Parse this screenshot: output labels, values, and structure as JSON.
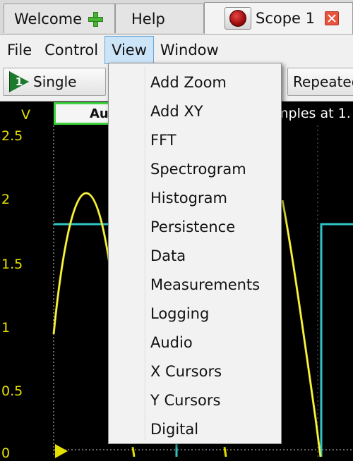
{
  "tabs": [
    {
      "label": "Welcome"
    },
    {
      "label": "Help"
    },
    {
      "label": "Scope 1"
    }
  ],
  "menubar": {
    "items": [
      "File",
      "Control",
      "View",
      "Window"
    ]
  },
  "toolbar": {
    "single_label": "Single",
    "single_icon_text": "1",
    "repeated_label": "Repeated"
  },
  "scope": {
    "unit_label": "V",
    "y_ticks": [
      "2.5",
      "2",
      "1.5",
      "1",
      "0.5",
      "0"
    ],
    "trigger_mode_text": "Au",
    "samples_text": "mples at 1."
  },
  "view_menu": {
    "items": [
      "Add Zoom",
      "Add XY",
      "FFT",
      "Spectrogram",
      "Histogram",
      "Persistence",
      "Data",
      "Measurements",
      "Logging",
      "Audio",
      "X Cursors",
      "Y Cursors",
      "Digital"
    ]
  },
  "colors": {
    "trace_channel_1": "#e6e000",
    "trace_channel_2": "#2ec4c4",
    "trigger_box_border": "#3fd33f"
  }
}
